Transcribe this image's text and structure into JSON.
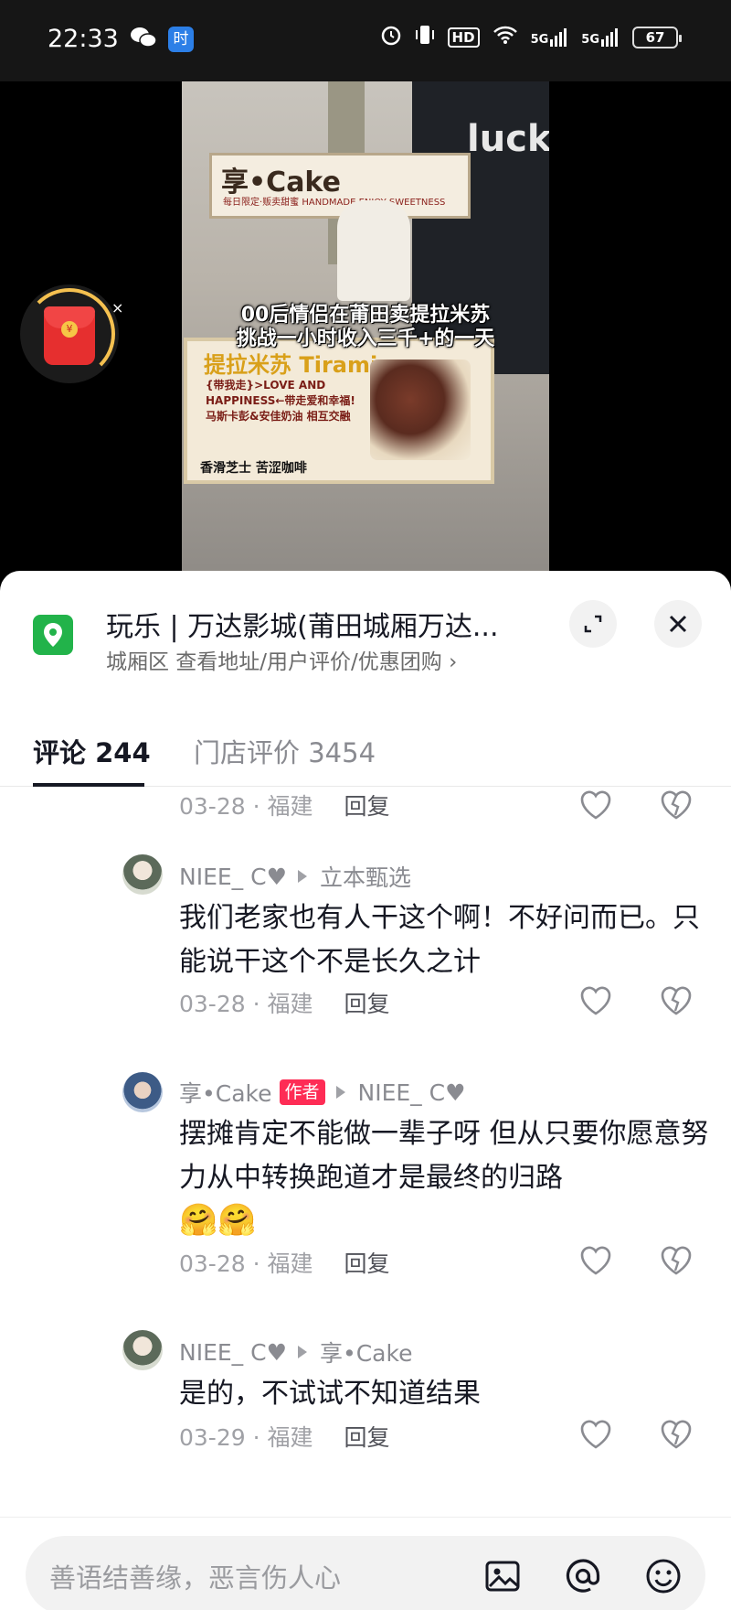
{
  "status_bar": {
    "time": "22:33",
    "left_icons": [
      "wechat-icon",
      "app-badge-icon"
    ],
    "app_badge_text": "时",
    "network_labels": [
      "HD",
      "5G",
      "5G"
    ],
    "battery": "67"
  },
  "video": {
    "sign_name": "享•Cake",
    "sign_sub": "每日限定·贩卖甜蜜 HANDMADE ENJOY SWEETNESS",
    "storefront_text": "lucki",
    "cart_title": "提拉米苏 Tiramisu",
    "cart_text": "{带我走}>LOVE AND HAPPINESS←带走爱和幸福! 马斯卡彭&安佳奶油 相互交融",
    "cart_bottom": "香滑芝士  苦涩咖啡",
    "subtitle_line1": "00后情侣在莆田卖提拉米苏",
    "subtitle_line2": "挑战一小时收入三千+的一天",
    "red_packet_close": "×"
  },
  "poi": {
    "title": "玩乐 | 万达影城(莆田城厢万达...",
    "subtitle": "城厢区  查看地址/用户评价/优惠团购 ›"
  },
  "tabs": [
    {
      "label": "评论 244",
      "active": true
    },
    {
      "label": "门店评价 3454",
      "active": false
    }
  ],
  "comments": [
    {
      "meta": "03-28 · 福建",
      "reply_label": "回复"
    },
    {
      "author": "NIEE_ C♥",
      "reply_to": "立本甄选",
      "text": "我们老家也有人干这个啊！不好问而已。只能说干这个不是长久之计",
      "meta": "03-28 · 福建",
      "reply_label": "回复"
    },
    {
      "author": "享•Cake",
      "author_badge": "作者",
      "reply_to": "NIEE_ C♥",
      "text": "摆摊肯定不能做一辈子呀 但从只要你愿意努力从中转换跑道才是最终的归路",
      "emoji": "🤗🤗",
      "meta": "03-28 · 福建",
      "reply_label": "回复"
    },
    {
      "author": "NIEE_ C♥",
      "reply_to": "享•Cake",
      "text": "是的，不试试不知道结果",
      "meta": "03-29 · 福建",
      "reply_label": "回复"
    }
  ],
  "input": {
    "placeholder": "善语结善缘，恶言伤人心"
  },
  "colors": {
    "accent": "#fe2c55",
    "poi_green": "#22b34a",
    "text_primary": "#161823",
    "text_secondary": "#8a8b91"
  }
}
